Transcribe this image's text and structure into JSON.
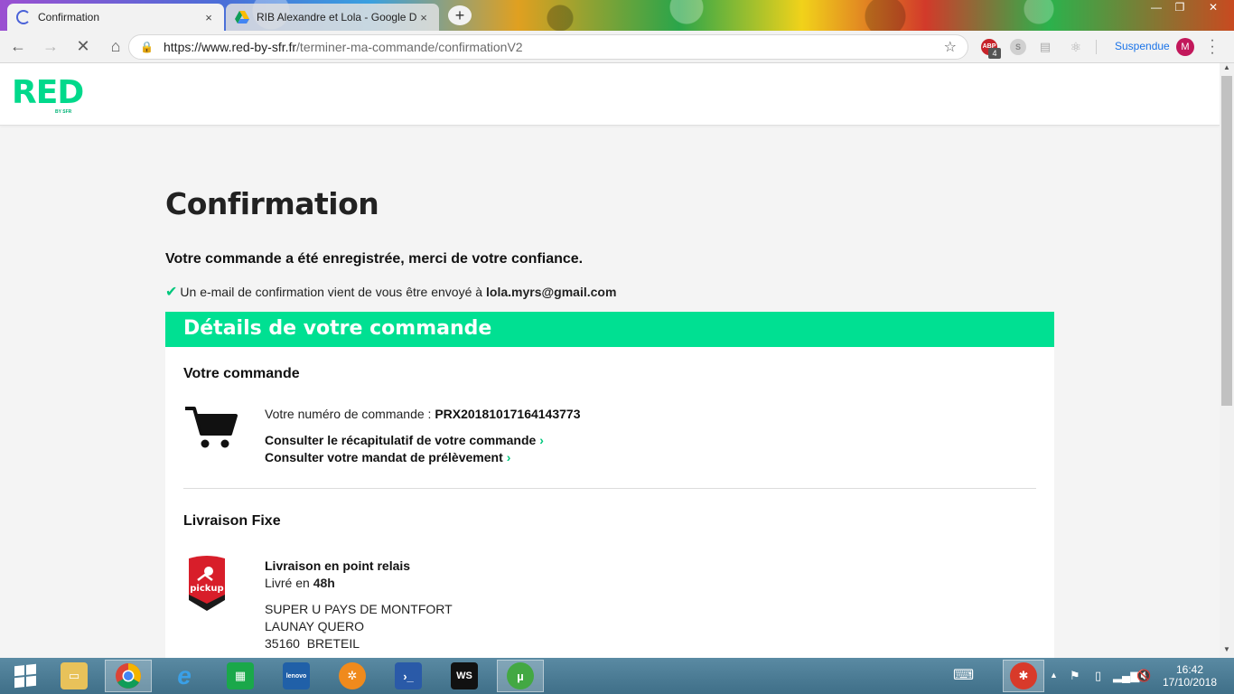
{
  "browser": {
    "tabs": [
      {
        "title": "Confirmation",
        "active": true
      },
      {
        "title": "RIB Alexandre et Lola - Google D",
        "active": false
      }
    ],
    "new_tab_symbol": "+",
    "close_symbol": "×",
    "window_controls": {
      "minimize": "—",
      "maximize": "❐",
      "close": "✕"
    },
    "nav": {
      "back": "←",
      "forward": "→",
      "stop": "✕",
      "home": "⌂"
    },
    "url": {
      "host": "https://www.red-by-sfr.fr",
      "path": "/terminer-ma-commande/confirmationV2"
    },
    "extensions": {
      "abp_label": "ABP",
      "abp_badge": "4",
      "s_label": "S"
    },
    "profile_status": "Suspendue",
    "avatar_initial": "M"
  },
  "site": {
    "logo_main": "RED",
    "logo_sub": "BY SFR"
  },
  "confirmation": {
    "title": "Confirmation",
    "thanks": "Votre commande a été enregistrée, merci de votre confiance.",
    "email_note_prefix": "Un e-mail de confirmation vient de vous être envoyé à",
    "email": "lola.myrs@gmail.com",
    "details_heading": "Détails de votre commande",
    "order_section_title": "Votre commande",
    "order_number_label": "Votre numéro de commande :",
    "order_number": "PRX20181017164143773",
    "link_recap": "Consulter le récapitulatif de votre commande",
    "link_mandate": "Consulter votre mandat de prélèvement",
    "chevron": "›",
    "delivery_section_title": "Livraison Fixe",
    "delivery_type": "Livraison en point relais",
    "delivery_time_prefix": "Livré en",
    "delivery_time": "48h",
    "relay_name": "SUPER U PAYS DE MONTFORT",
    "relay_street": "LAUNAY QUERO",
    "relay_city": "35160  BRETEIL",
    "pickup_logo_text": "pickup"
  },
  "taskbar": {
    "time": "16:42",
    "date": "17/10/2018"
  },
  "colors": {
    "brand_green": "#00e092",
    "logo_green": "#00d98b",
    "check_green": "#00c77c",
    "profile_blue": "#1a73e8",
    "avatar": "#c2185b"
  }
}
